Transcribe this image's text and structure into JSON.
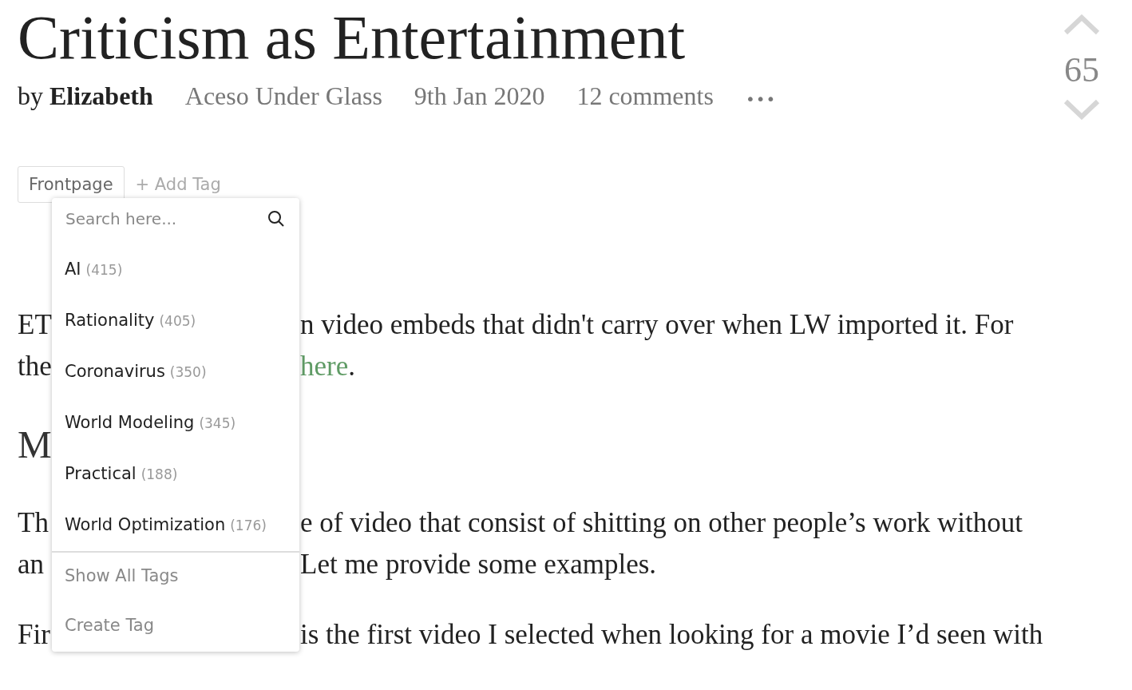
{
  "post": {
    "title": "Criticism as Entertainment",
    "by": "by",
    "author": "Elizabeth",
    "blog": "Aceso Under Glass",
    "date": "9th Jan 2020",
    "comments": "12 comments",
    "menu": "•••"
  },
  "vote": {
    "score": "65"
  },
  "tags": {
    "items": [
      {
        "label": "Frontpage"
      }
    ],
    "add": "+ Add Tag"
  },
  "tag_menu": {
    "placeholder": "Search here...",
    "items": [
      {
        "name": "AI",
        "count": "(415)"
      },
      {
        "name": "Rationality",
        "count": "(405)"
      },
      {
        "name": "Coronavirus",
        "count": "(350)"
      },
      {
        "name": "World Modeling",
        "count": "(345)"
      },
      {
        "name": "Practical",
        "count": "(188)"
      },
      {
        "name": "World Optimization",
        "count": "(176)"
      }
    ],
    "actions": [
      "Show All Tags",
      "Create Tag"
    ]
  },
  "body": [
    {
      "kind": "paragraph",
      "lines": [
        {
          "left": "ET",
          "right": "n video embeds that didn't carry over when LW imported it. For"
        },
        {
          "left": "the",
          "link": "here",
          "right": "."
        }
      ]
    },
    {
      "kind": "heading",
      "text": "M"
    },
    {
      "kind": "paragraph",
      "lines": [
        {
          "left": "Th",
          "right": "e of video that consist of shitting on other people’s work without"
        },
        {
          "left": "an",
          "right": "Let me provide some examples."
        }
      ]
    },
    {
      "kind": "paragraph",
      "lines": [
        {
          "left": "Fir",
          "right": "is the first video I selected when looking for a movie I’d seen with"
        }
      ]
    }
  ]
}
